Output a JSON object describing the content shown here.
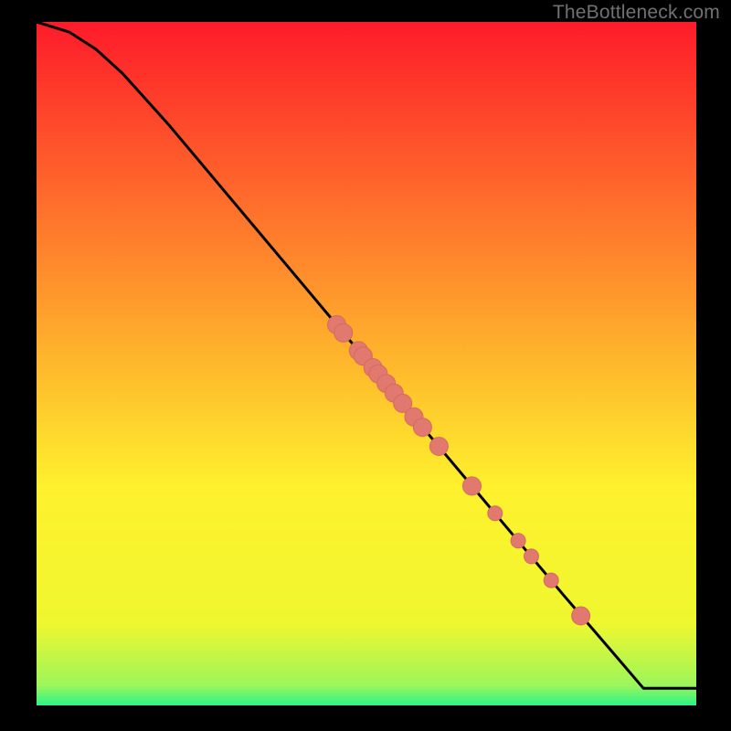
{
  "watermark": "TheBottleneck.com",
  "colors": {
    "gradient_top": "#fe1b2a",
    "gradient_mid1": "#ff8b2c",
    "gradient_mid2": "#fef12d",
    "gradient_mid3": "#eff72e",
    "gradient_bottom": "#2bf387",
    "curve": "#000000",
    "dot_fill": "#e1796e",
    "dot_stroke": "#d46a60"
  },
  "chart_data": {
    "type": "line",
    "title": "",
    "xlabel": "",
    "ylabel": "",
    "xlim": [
      0,
      100
    ],
    "ylim": [
      0,
      100
    ],
    "curve": {
      "x": [
        0,
        5,
        9,
        13,
        20,
        30,
        40,
        50,
        60,
        70,
        80,
        88,
        92,
        100
      ],
      "y": [
        100,
        98.5,
        96,
        92.5,
        85,
        73.5,
        62,
        50.5,
        39,
        27.5,
        16,
        7,
        2.5,
        2.5
      ]
    },
    "series": [
      {
        "name": "highlighted-points",
        "x": [
          45.5,
          46.5,
          48.8,
          49.5,
          51.0,
          51.8,
          53.0,
          54.2,
          55.5,
          57.2,
          58.5,
          61.0,
          66.0,
          69.5,
          73.0,
          75.0,
          78.0,
          82.5
        ],
        "y": [
          55.7,
          54.5,
          51.9,
          51.1,
          49.4,
          48.5,
          47.1,
          45.7,
          44.2,
          42.2,
          40.7,
          37.9,
          32.1,
          28.1,
          24.1,
          21.8,
          18.3,
          13.1
        ]
      }
    ],
    "dot_radius": [
      10,
      10,
      10,
      10,
      10,
      10,
      10,
      10,
      10,
      10,
      10,
      10,
      10,
      8,
      8,
      8,
      8,
      10
    ]
  }
}
